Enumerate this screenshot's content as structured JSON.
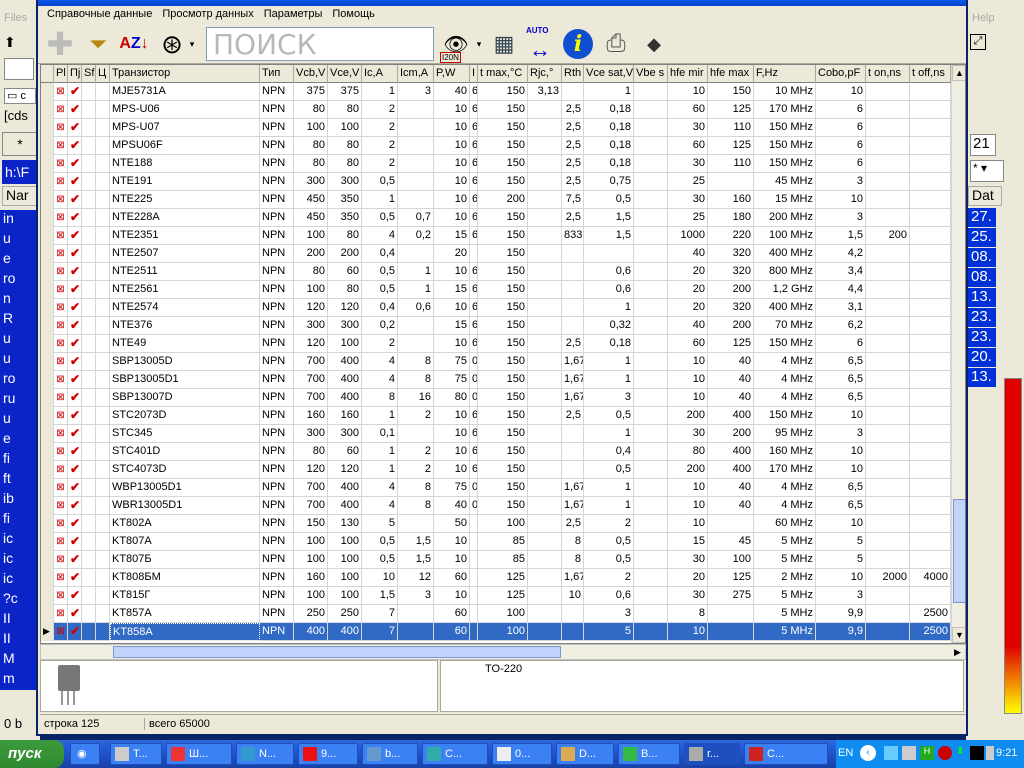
{
  "background_left": {
    "top_labels": [
      "Files"
    ],
    "rows": [
      "in",
      "u",
      "e",
      "ro",
      "n",
      "R",
      "u",
      "u",
      "ro",
      "ru",
      "u",
      "e",
      "fi",
      "ft",
      "ib",
      "fi",
      "ic",
      "ic",
      "ic",
      "?c",
      "II",
      "II",
      "M",
      "m"
    ],
    "bottom": "0 b"
  },
  "background_right": {
    "help": "Help",
    "dat": "Dat",
    "values": [
      "27.",
      "25.",
      "08.",
      "08.",
      "13.",
      "23.",
      "23.",
      "20.",
      "13."
    ],
    "time": "21"
  },
  "menu": [
    "Справочные данные",
    "Просмотр данных",
    "Параметры",
    "Помощь"
  ],
  "toolbar": {
    "search_placeholder": "ПОИСК",
    "auto_label": "AUTO",
    "filter_badge": "I20N"
  },
  "columns": [
    "Pl",
    "Пј",
    "Sf",
    "Ц",
    "Транзистор",
    "Тип",
    "Vcb,V",
    "Vce,V",
    "Ic,A",
    "Icm,A",
    "P,W",
    "I",
    "t max,°C",
    "Rjc,°",
    "Rth",
    "Vce sat,V",
    "Vbe s",
    "hfe mir",
    "hfe max",
    "F,Hz",
    "Cobo,pF",
    "t on,ns",
    "t off,ns"
  ],
  "rows": [
    [
      "MJE5731A",
      "NPN",
      "375",
      "375",
      "1",
      "3",
      "40",
      "6",
      "150",
      "3,13",
      "",
      "1",
      "",
      "10",
      "150",
      "10 MHz",
      "10",
      "",
      ""
    ],
    [
      "MPS-U06",
      "NPN",
      "80",
      "80",
      "2",
      "",
      "10",
      "6",
      "150",
      "",
      "2,5",
      "0,18",
      "",
      "60",
      "125",
      "170 MHz",
      "6",
      "",
      ""
    ],
    [
      "MPS-U07",
      "NPN",
      "100",
      "100",
      "2",
      "",
      "10",
      "6",
      "150",
      "",
      "2,5",
      "0,18",
      "",
      "30",
      "110",
      "150 MHz",
      "6",
      "",
      ""
    ],
    [
      "MPSU06F",
      "NPN",
      "80",
      "80",
      "2",
      "",
      "10",
      "6",
      "150",
      "",
      "2,5",
      "0,18",
      "",
      "60",
      "125",
      "150 MHz",
      "6",
      "",
      ""
    ],
    [
      "NTE188",
      "NPN",
      "80",
      "80",
      "2",
      "",
      "10",
      "6",
      "150",
      "",
      "2,5",
      "0,18",
      "",
      "30",
      "110",
      "150 MHz",
      "6",
      "",
      ""
    ],
    [
      "NTE191",
      "NPN",
      "300",
      "300",
      "0,5",
      "",
      "10",
      "6",
      "150",
      "",
      "2,5",
      "0,75",
      "",
      "25",
      "",
      "45 MHz",
      "3",
      "",
      ""
    ],
    [
      "NTE225",
      "NPN",
      "450",
      "350",
      "1",
      "",
      "10",
      "6",
      "200",
      "",
      "7,5",
      "0,5",
      "",
      "30",
      "160",
      "15 MHz",
      "10",
      "",
      ""
    ],
    [
      "NTE228A",
      "NPN",
      "450",
      "350",
      "0,5",
      "0,7",
      "10",
      "6",
      "150",
      "",
      "2,5",
      "1,5",
      "",
      "25",
      "180",
      "200 MHz",
      "3",
      "",
      ""
    ],
    [
      "NTE2351",
      "NPN",
      "100",
      "80",
      "4",
      "0,2",
      "15",
      "6",
      "150",
      "",
      "833",
      "1,5",
      "",
      "1000",
      "220",
      "100 MHz",
      "1,5",
      "200",
      ""
    ],
    [
      "NTE2507",
      "NPN",
      "200",
      "200",
      "0,4",
      "",
      "20",
      "",
      "150",
      "",
      "",
      "",
      "",
      "40",
      "320",
      "400 MHz",
      "4,2",
      "",
      ""
    ],
    [
      "NTE2511",
      "NPN",
      "80",
      "60",
      "0,5",
      "1",
      "10",
      "6",
      "150",
      "",
      "",
      "0,6",
      "",
      "20",
      "320",
      "800 MHz",
      "3,4",
      "",
      ""
    ],
    [
      "NTE2561",
      "NPN",
      "100",
      "80",
      "0,5",
      "1",
      "15",
      "6",
      "150",
      "",
      "",
      "0,6",
      "",
      "20",
      "200",
      "1,2 GHz",
      "4,4",
      "",
      ""
    ],
    [
      "NTE2574",
      "NPN",
      "120",
      "120",
      "0,4",
      "0,6",
      "10",
      "6",
      "150",
      "",
      "",
      "1",
      "",
      "20",
      "320",
      "400 MHz",
      "3,1",
      "",
      ""
    ],
    [
      "NTE376",
      "NPN",
      "300",
      "300",
      "0,2",
      "",
      "15",
      "6",
      "150",
      "",
      "",
      "0,32",
      "",
      "40",
      "200",
      "70 MHz",
      "6,2",
      "",
      ""
    ],
    [
      "NTE49",
      "NPN",
      "120",
      "100",
      "2",
      "",
      "10",
      "6",
      "150",
      "",
      "2,5",
      "0,18",
      "",
      "60",
      "125",
      "150 MHz",
      "6",
      "",
      ""
    ],
    [
      "SBP13005D",
      "NPN",
      "700",
      "400",
      "4",
      "8",
      "75",
      "0",
      "150",
      "",
      "1,67",
      "1",
      "",
      "10",
      "40",
      "4 MHz",
      "6,5",
      "",
      ""
    ],
    [
      "SBP13005D1",
      "NPN",
      "700",
      "400",
      "4",
      "8",
      "75",
      "0",
      "150",
      "",
      "1,67",
      "1",
      "",
      "10",
      "40",
      "4 MHz",
      "6,5",
      "",
      ""
    ],
    [
      "SBP13007D",
      "NPN",
      "700",
      "400",
      "8",
      "16",
      "80",
      "0",
      "150",
      "",
      "1,67",
      "3",
      "",
      "10",
      "40",
      "4 MHz",
      "6,5",
      "",
      ""
    ],
    [
      "STC2073D",
      "NPN",
      "160",
      "160",
      "1",
      "2",
      "10",
      "6",
      "150",
      "",
      "2,5",
      "0,5",
      "",
      "200",
      "400",
      "150 MHz",
      "10",
      "",
      ""
    ],
    [
      "STC345",
      "NPN",
      "300",
      "300",
      "0,1",
      "",
      "10",
      "6",
      "150",
      "",
      "",
      "1",
      "",
      "30",
      "200",
      "95 MHz",
      "3",
      "",
      ""
    ],
    [
      "STC401D",
      "NPN",
      "80",
      "60",
      "1",
      "2",
      "10",
      "6",
      "150",
      "",
      "",
      "0,4",
      "",
      "80",
      "400",
      "160 MHz",
      "10",
      "",
      ""
    ],
    [
      "STC4073D",
      "NPN",
      "120",
      "120",
      "1",
      "2",
      "10",
      "6",
      "150",
      "",
      "",
      "0,5",
      "",
      "200",
      "400",
      "170 MHz",
      "10",
      "",
      ""
    ],
    [
      "WBP13005D1",
      "NPN",
      "700",
      "400",
      "4",
      "8",
      "75",
      "0",
      "150",
      "",
      "1,67",
      "1",
      "",
      "10",
      "40",
      "4 MHz",
      "6,5",
      "",
      ""
    ],
    [
      "WBR13005D1",
      "NPN",
      "700",
      "400",
      "4",
      "8",
      "40",
      "0",
      "150",
      "",
      "1,67",
      "1",
      "",
      "10",
      "40",
      "4 MHz",
      "6,5",
      "",
      ""
    ],
    [
      "KT802A",
      "NPN",
      "150",
      "130",
      "5",
      "",
      "50",
      "",
      "100",
      "",
      "2,5",
      "2",
      "",
      "10",
      "",
      "60 MHz",
      "10",
      "",
      ""
    ],
    [
      "KT807A",
      "NPN",
      "100",
      "100",
      "0,5",
      "1,5",
      "10",
      "",
      "85",
      "",
      "8",
      "0,5",
      "",
      "15",
      "45",
      "5 MHz",
      "5",
      "",
      ""
    ],
    [
      "KT807Б",
      "NPN",
      "100",
      "100",
      "0,5",
      "1,5",
      "10",
      "",
      "85",
      "",
      "8",
      "0,5",
      "",
      "30",
      "100",
      "5 MHz",
      "5",
      "",
      ""
    ],
    [
      "KT808БМ",
      "NPN",
      "160",
      "100",
      "10",
      "12",
      "60",
      "",
      "125",
      "",
      "1,67",
      "2",
      "",
      "20",
      "125",
      "2 MHz",
      "10",
      "2000",
      "4000"
    ],
    [
      "KT815Г",
      "NPN",
      "100",
      "100",
      "1,5",
      "3",
      "10",
      "",
      "125",
      "",
      "10",
      "0,6",
      "",
      "30",
      "275",
      "5 MHz",
      "3",
      "",
      ""
    ],
    [
      "KT857A",
      "NPN",
      "250",
      "250",
      "7",
      "",
      "60",
      "",
      "100",
      "",
      "",
      "3",
      "",
      "8",
      "",
      "5 MHz",
      "9,9",
      "",
      "2500"
    ],
    [
      "KT858A",
      "NPN",
      "400",
      "400",
      "7",
      "",
      "60",
      "",
      "100",
      "",
      "",
      "5",
      "",
      "10",
      "",
      "5 MHz",
      "9,9",
      "",
      "2500"
    ]
  ],
  "selected_row": 30,
  "package": "TO-220",
  "status": {
    "row": "строка 125",
    "total": "всего 65000"
  },
  "taskbar": {
    "start": "пуск",
    "tasks": [
      "T...",
      "Ш...",
      "N...",
      "9...",
      "b...",
      "C...",
      "0...",
      "D...",
      "B...",
      "r...",
      "C..."
    ],
    "lang": "EN",
    "time": "9:21"
  },
  "colors": {
    "selection": "#316ac5",
    "check": "#d00000",
    "taskbar": "#245edb"
  }
}
